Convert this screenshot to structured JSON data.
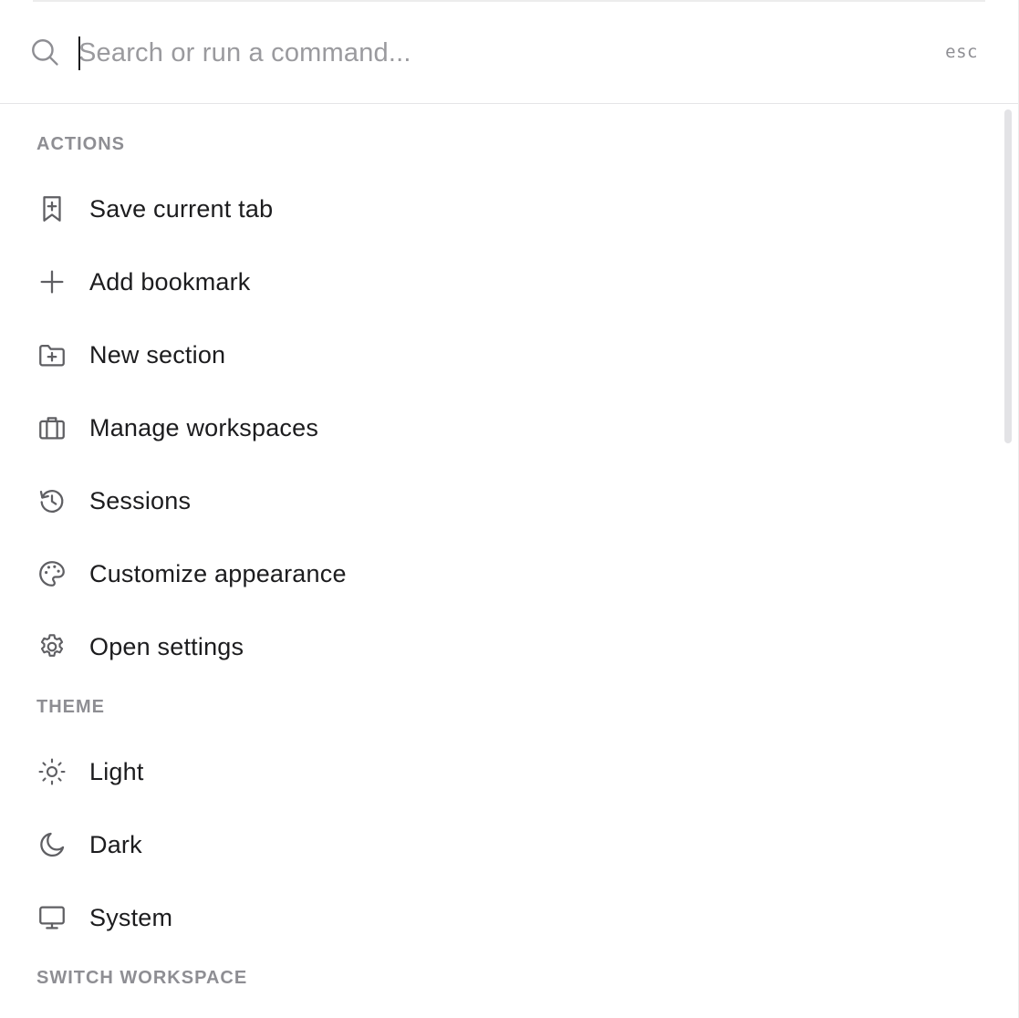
{
  "search": {
    "placeholder": "Search or run a command...",
    "value": "",
    "esc_hint": "esc"
  },
  "sections": {
    "actions": {
      "title": "ACTIONS",
      "items": [
        {
          "label": "Save current tab",
          "icon": "bookmark-plus-icon"
        },
        {
          "label": "Add bookmark",
          "icon": "plus-icon"
        },
        {
          "label": "New section",
          "icon": "folder-plus-icon"
        },
        {
          "label": "Manage workspaces",
          "icon": "briefcase-icon"
        },
        {
          "label": "Sessions",
          "icon": "history-icon"
        },
        {
          "label": "Customize appearance",
          "icon": "palette-icon"
        },
        {
          "label": "Open settings",
          "icon": "gear-icon"
        }
      ]
    },
    "theme": {
      "title": "THEME",
      "items": [
        {
          "label": "Light",
          "icon": "sun-icon"
        },
        {
          "label": "Dark",
          "icon": "moon-icon"
        },
        {
          "label": "System",
          "icon": "monitor-icon"
        }
      ]
    },
    "switch_workspace": {
      "title": "SWITCH WORKSPACE"
    }
  }
}
